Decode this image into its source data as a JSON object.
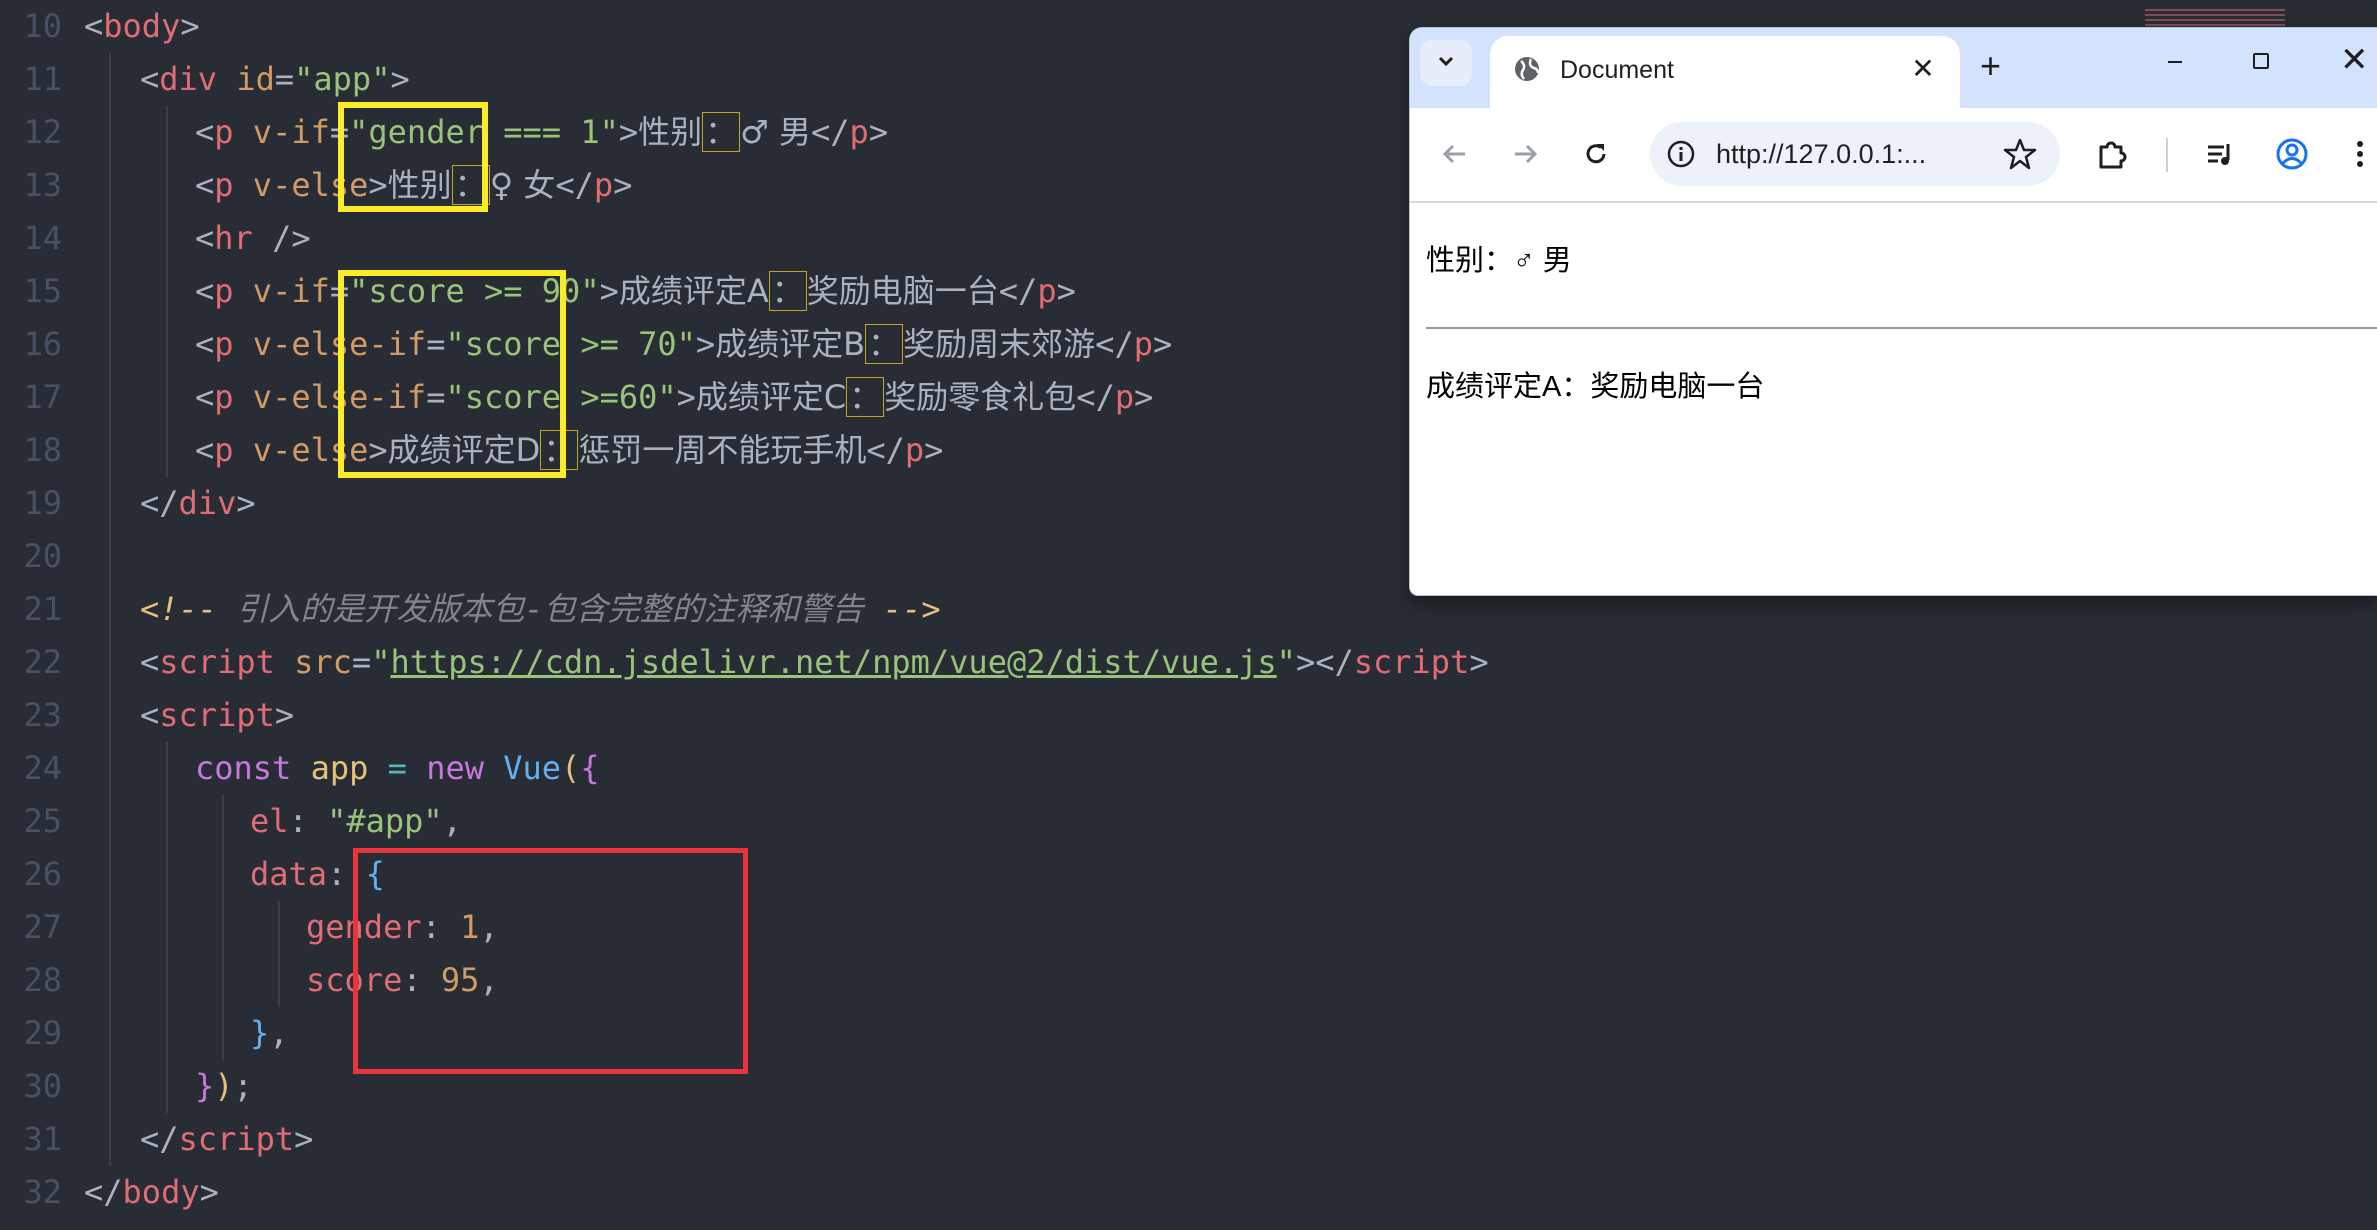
{
  "editor": {
    "line_numbers": [
      "10",
      "11",
      "12",
      "13",
      "14",
      "15",
      "16",
      "17",
      "18",
      "19",
      "20",
      "21",
      "22",
      "23",
      "24",
      "25",
      "26",
      "27",
      "28",
      "29",
      "30",
      "31",
      "32"
    ],
    "l10": {
      "lt": "<",
      "tag": "body",
      "gt": ">"
    },
    "l11": {
      "lt": "<",
      "tag": "div",
      "attr": " id",
      "eq": "=",
      "str": "\"app\"",
      "gt": ">"
    },
    "l12": {
      "lt": "<",
      "tag": "p",
      "attr": " v-if",
      "eq": "=",
      "str": "\"gender === 1\"",
      "gt": ">",
      "t1": "性别",
      "colon": "：",
      "t2": "♂ 男",
      "clt": "</",
      "ctag": "p",
      "cgt": ">"
    },
    "l13": {
      "lt": "<",
      "tag": "p",
      "attr": " v-else",
      "gt": ">",
      "t1": "性别",
      "colon": "：",
      "t2": "♀ 女",
      "clt": "</",
      "ctag": "p",
      "cgt": ">"
    },
    "l14": {
      "lt": "<",
      "tag": "hr",
      "rest": " />"
    },
    "l15": {
      "lt": "<",
      "tag": "p",
      "attr": " v-if",
      "eq": "=",
      "str": "\"score >= 90\"",
      "gt": ">",
      "t1": "成绩评定A",
      "colon": "：",
      "t2": "奖励电脑一台",
      "clt": "</",
      "ctag": "p",
      "cgt": ">"
    },
    "l16": {
      "lt": "<",
      "tag": "p",
      "attr": " v-else-if",
      "eq": "=",
      "str": "\"score >= 70\"",
      "gt": ">",
      "t1": "成绩评定B",
      "colon": "：",
      "t2": "奖励周末郊游",
      "clt": "</",
      "ctag": "p",
      "cgt": ">"
    },
    "l17": {
      "lt": "<",
      "tag": "p",
      "attr": " v-else-if",
      "eq": "=",
      "str": "\"score >=60\"",
      "gt": ">",
      "t1": "成绩评定C",
      "colon": "：",
      "t2": "奖励零食礼包",
      "clt": "</",
      "ctag": "p",
      "cgt": ">"
    },
    "l18": {
      "lt": "<",
      "tag": "p",
      "attr": " v-else",
      "gt": ">",
      "t1": "成绩评定D",
      "colon": "：",
      "t2": "惩罚一周不能玩手机",
      "clt": "</",
      "ctag": "p",
      "cgt": ">"
    },
    "l19": {
      "lt": "</",
      "tag": "div",
      "gt": ">"
    },
    "l21": {
      "open": "<!--",
      "text": " 引入的是开发版本包-包含完整的注释和警告 ",
      "close": "-->"
    },
    "l22": {
      "lt": "<",
      "tag": "script",
      "attr": " src",
      "eq": "=",
      "q1": "\"",
      "url": "https://cdn.jsdelivr.net/npm/vue@2/dist/vue.js",
      "q2": "\"",
      "gt": "></",
      "ctag": "script",
      "cgt": ">"
    },
    "l23": {
      "lt": "<",
      "tag": "script",
      "gt": ">"
    },
    "l24": {
      "kw": "const",
      "var": " app ",
      "op": "=",
      "kw2": " new ",
      "cls": "Vue",
      "paren": "(",
      "brace": "{"
    },
    "l25": {
      "prop": "el",
      "colon": ": ",
      "str": "\"#app\"",
      "comma": ","
    },
    "l26": {
      "prop": "data",
      "colon": ": ",
      "brace": "{"
    },
    "l27": {
      "prop": "gender",
      "colon": ": ",
      "num": "1",
      "comma": ","
    },
    "l28": {
      "prop": "score",
      "colon": ": ",
      "num": "95",
      "comma": ","
    },
    "l29": {
      "brace": "}",
      "comma": ","
    },
    "l30": {
      "brace": "}",
      "paren": ")",
      "semi": ";"
    },
    "l31": {
      "lt": "</",
      "tag": "script",
      "gt": ">"
    },
    "l32": {
      "lt": "</",
      "tag": "body",
      "gt": ">"
    }
  },
  "browser": {
    "tab_title": "Document",
    "url": "http://127.0.0.1:...",
    "new_tab_glyph": "+",
    "tab_close_glyph": "✕",
    "window_close_glyph": "✕",
    "page": {
      "gender_line": "性别：♂ 男",
      "score_line": "成绩评定A：奖励电脑一台"
    }
  },
  "colors": {
    "editor_bg": "#282c34",
    "highlight_yellow": "#fbec29",
    "highlight_red": "#e8343a",
    "browser_tabbar": "#d3e3fd"
  },
  "icons": [
    "tab-search-icon",
    "globe-icon",
    "back-arrow-icon",
    "forward-arrow-icon",
    "reload-icon",
    "info-icon",
    "star-icon",
    "extensions-icon",
    "media-control-icon",
    "profile-icon",
    "kebab-menu-icon"
  ]
}
